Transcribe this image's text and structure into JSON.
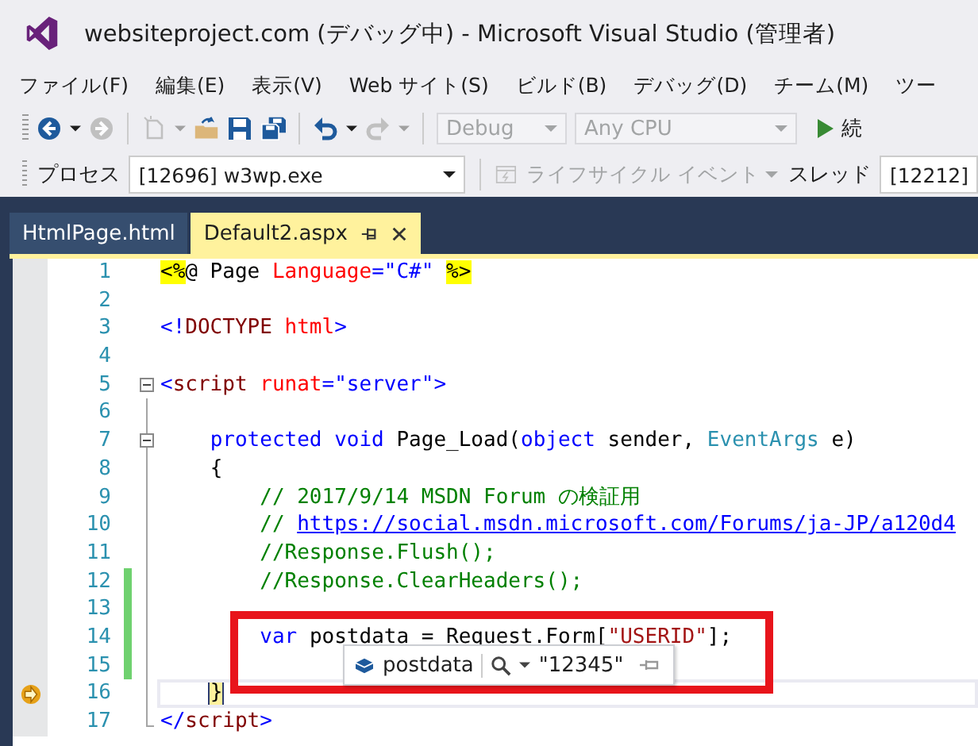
{
  "window": {
    "title": "websiteproject.com (デバッグ中) - Microsoft Visual Studio (管理者)"
  },
  "menu": [
    "ファイル(F)",
    "編集(E)",
    "表示(V)",
    "Web サイト(S)",
    "ビルド(B)",
    "デバッグ(D)",
    "チーム(M)",
    "ツー"
  ],
  "toolbar": {
    "back": {
      "disabled": false
    },
    "forward": {
      "disabled": true
    },
    "new_item": {
      "disabled": true
    },
    "open": {
      "disabled": false
    },
    "save": {
      "disabled": false
    },
    "save_all": {
      "disabled": false
    },
    "undo": {
      "disabled": false
    },
    "redo": {
      "disabled": true
    },
    "configuration": {
      "value": "Debug",
      "disabled": true
    },
    "platform": {
      "value": "Any CPU",
      "disabled": true
    },
    "start": {
      "label": "続"
    }
  },
  "debug_bar": {
    "process_label": "プロセス",
    "process": "[12696] w3wp.exe",
    "lifecycle": {
      "label": "ライフサイクル イベント",
      "disabled": true
    },
    "thread_label": "スレッド",
    "thread": "[12212]"
  },
  "tabs": [
    {
      "label": "HtmlPage.html",
      "selected": false
    },
    {
      "label": "Default2.aspx",
      "selected": true
    }
  ],
  "lines": [
    {
      "number": "1",
      "collapsible": false,
      "outlined": false,
      "changed": false,
      "current": false,
      "tokens": [
        {
          "kind": "directive",
          "text": "<%"
        },
        {
          "kind": "plain",
          "text": "@ Page"
        },
        {
          "kind": "attr",
          "text": " Language"
        },
        {
          "kind": "punct",
          "text": "=\"C#\" "
        },
        {
          "kind": "directive",
          "text": "%>"
        }
      ]
    },
    {
      "number": "2",
      "collapsible": false,
      "outlined": false,
      "changed": false,
      "current": false
    },
    {
      "number": "3",
      "collapsible": false,
      "outlined": false,
      "changed": false,
      "current": false,
      "tokens": [
        {
          "kind": "punct",
          "text": "<!"
        },
        {
          "kind": "tag",
          "text": "DOCTYPE"
        },
        {
          "kind": "attr",
          "text": " html"
        },
        {
          "kind": "punct",
          "text": ">"
        }
      ]
    },
    {
      "number": "4",
      "collapsible": false,
      "outlined": false,
      "changed": false,
      "current": false
    },
    {
      "number": "5",
      "collapsible": true,
      "outlined": false,
      "changed": false,
      "current": false,
      "tokens": [
        {
          "kind": "punct",
          "text": "<"
        },
        {
          "kind": "tag",
          "text": "script"
        },
        {
          "kind": "attr",
          "text": " runat"
        },
        {
          "kind": "punct",
          "text": "=\"server\">"
        }
      ]
    },
    {
      "number": "6",
      "collapsible": false,
      "outlined": true,
      "changed": false,
      "current": false
    },
    {
      "number": "7",
      "collapsible": true,
      "outlined": true,
      "changed": false,
      "current": false,
      "tokens": [
        {
          "kind": "keyword",
          "text": "    protected void"
        },
        {
          "kind": "plain",
          "text": " Page_Load("
        },
        {
          "kind": "keyword",
          "text": "object"
        },
        {
          "kind": "plain",
          "text": " sender, "
        },
        {
          "kind": "type",
          "text": "EventArgs"
        },
        {
          "kind": "plain",
          "text": " e)"
        }
      ]
    },
    {
      "number": "8",
      "collapsible": false,
      "outlined": true,
      "changed": false,
      "current": false,
      "tokens": [
        {
          "kind": "plain",
          "text": "    {"
        }
      ]
    },
    {
      "number": "9",
      "collapsible": false,
      "outlined": true,
      "changed": false,
      "current": false,
      "tokens": [
        {
          "kind": "comment",
          "text": "        // 2017/9/14 MSDN Forum の検証用"
        }
      ]
    },
    {
      "number": "10",
      "collapsible": false,
      "outlined": true,
      "changed": false,
      "current": false,
      "tokens": [
        {
          "kind": "comment",
          "text": "        // "
        },
        {
          "kind": "link",
          "text": "https://social.msdn.microsoft.com/Forums/ja-JP/a120d4"
        }
      ]
    },
    {
      "number": "11",
      "collapsible": false,
      "outlined": true,
      "changed": false,
      "current": false,
      "tokens": [
        {
          "kind": "comment",
          "text": "        //Response.Flush();"
        }
      ]
    },
    {
      "number": "12",
      "collapsible": false,
      "outlined": true,
      "changed": true,
      "current": false,
      "tokens": [
        {
          "kind": "comment",
          "text": "        //Response.ClearHeaders();"
        }
      ]
    },
    {
      "number": "13",
      "collapsible": false,
      "outlined": true,
      "changed": true,
      "current": false
    },
    {
      "number": "14",
      "collapsible": false,
      "outlined": true,
      "changed": true,
      "current": false,
      "tokens": [
        {
          "kind": "keyword",
          "text": "        var"
        },
        {
          "kind": "plain",
          "text": " postdata = Request.Form["
        },
        {
          "kind": "string",
          "text": "\"USERID\""
        },
        {
          "kind": "plain",
          "text": "];"
        }
      ]
    },
    {
      "number": "15",
      "collapsible": false,
      "outlined": true,
      "changed": true,
      "current": false
    },
    {
      "number": "16",
      "collapsible": false,
      "outlined": true,
      "changed": false,
      "current": true,
      "tokens": [
        {
          "kind": "caret",
          "text": "    }"
        }
      ]
    },
    {
      "number": "17",
      "collapsible": false,
      "outlined": true,
      "changed": false,
      "current": false,
      "tokens": [
        {
          "kind": "punct",
          "text": "</"
        },
        {
          "kind": "tag",
          "text": "script"
        },
        {
          "kind": "punct",
          "text": ">"
        }
      ]
    }
  ],
  "datatip": {
    "name": "postdata",
    "value": "\"12345\""
  }
}
